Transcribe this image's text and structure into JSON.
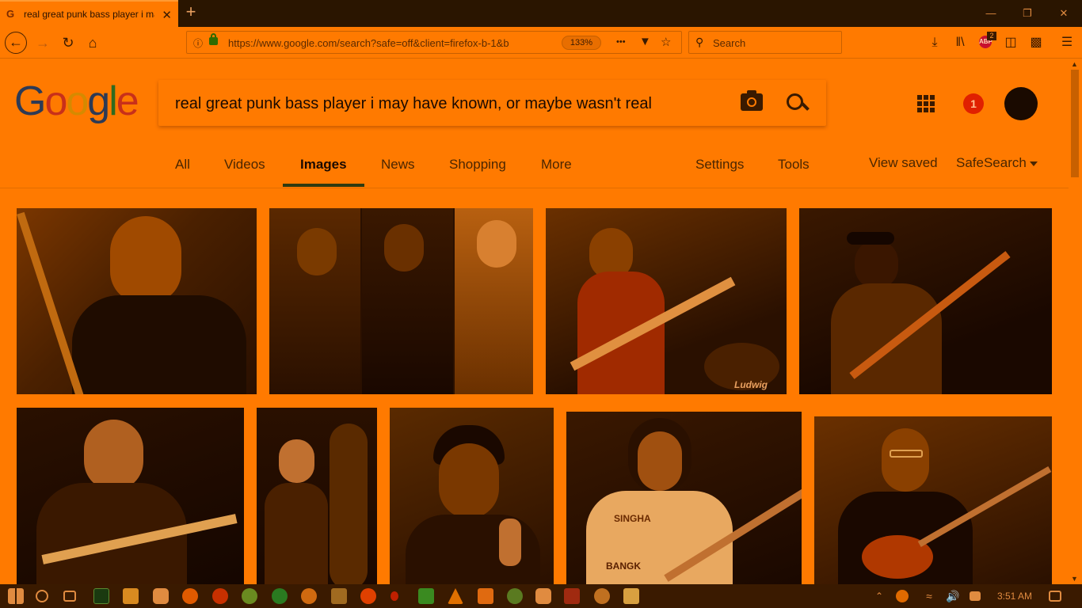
{
  "browser": {
    "tab_title": "real great punk bass player i may have known",
    "tab_favicon": "G",
    "tab_close": "✕",
    "new_tab": "+",
    "url": "https://www.google.com/search?safe=off&client=firefox-b-1&b",
    "zoom": "133%",
    "search_placeholder": "Search",
    "more_dots": "•••",
    "abp_label": "ABP",
    "abp_count": "2"
  },
  "google": {
    "query": "real great punk bass player i may have known, or maybe wasn't real",
    "logo_letters": [
      "G",
      "o",
      "o",
      "g",
      "l",
      "e"
    ],
    "notification_count": "1",
    "tabs": {
      "all": "All",
      "videos": "Videos",
      "images": "Images",
      "news": "News",
      "shopping": "Shopping",
      "more": "More",
      "settings": "Settings",
      "tools": "Tools",
      "view_saved": "View saved",
      "safesearch": "SafeSearch"
    }
  },
  "image_labels": {
    "kick_drum": "Ludwig",
    "tshirt": "SINGHA",
    "tshirt_sub": "BANGK"
  },
  "taskbar": {
    "clock": "3:51 AM"
  },
  "colors": {
    "page": "#ff7a00",
    "titlebar": "#2a1500",
    "taskbar": "#3a1a00",
    "active_tab_underline": "#2e3a10",
    "notification": "#e02000"
  }
}
